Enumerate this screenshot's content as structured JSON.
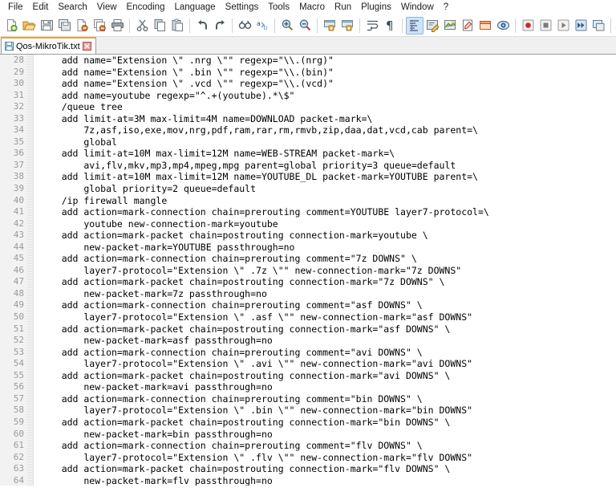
{
  "app": {
    "name": "Notepad++",
    "accent_color": "#e8a33d",
    "toolbar_active_bg": "#cfe3f7"
  },
  "menubar": {
    "items": [
      {
        "label": "File",
        "name": "menu-file"
      },
      {
        "label": "Edit",
        "name": "menu-edit"
      },
      {
        "label": "Search",
        "name": "menu-search"
      },
      {
        "label": "View",
        "name": "menu-view"
      },
      {
        "label": "Encoding",
        "name": "menu-encoding"
      },
      {
        "label": "Language",
        "name": "menu-language"
      },
      {
        "label": "Settings",
        "name": "menu-settings"
      },
      {
        "label": "Tools",
        "name": "menu-tools"
      },
      {
        "label": "Macro",
        "name": "menu-macro"
      },
      {
        "label": "Run",
        "name": "menu-run"
      },
      {
        "label": "Plugins",
        "name": "menu-plugins"
      },
      {
        "label": "Window",
        "name": "menu-window"
      },
      {
        "label": "?",
        "name": "menu-help"
      }
    ]
  },
  "toolbar": {
    "buttons": [
      {
        "icon": "new-file-icon",
        "group": 1
      },
      {
        "icon": "open-file-icon",
        "group": 1
      },
      {
        "icon": "save-icon",
        "group": 1
      },
      {
        "icon": "save-all-icon",
        "group": 1
      },
      {
        "icon": "close-file-icon",
        "group": 1
      },
      {
        "icon": "close-all-files-icon",
        "group": 1
      },
      {
        "icon": "print-icon",
        "group": 1
      },
      {
        "icon": "cut-icon",
        "group": 2
      },
      {
        "icon": "copy-icon",
        "group": 2
      },
      {
        "icon": "paste-icon",
        "group": 2
      },
      {
        "icon": "undo-icon",
        "group": 3
      },
      {
        "icon": "redo-icon",
        "group": 3
      },
      {
        "icon": "find-icon",
        "group": 4
      },
      {
        "icon": "replace-icon",
        "group": 4
      },
      {
        "icon": "zoom-in-icon",
        "group": 5
      },
      {
        "icon": "zoom-out-icon",
        "group": 5
      },
      {
        "icon": "sync-vertical-scroll-icon",
        "group": 6
      },
      {
        "icon": "sync-horizontal-scroll-icon",
        "group": 6
      },
      {
        "icon": "word-wrap-icon",
        "group": 7
      },
      {
        "icon": "show-all-characters-icon",
        "group": 7
      },
      {
        "icon": "indent-guide-icon",
        "group": 8,
        "active": true
      },
      {
        "icon": "user-defined-language-icon",
        "group": 8
      },
      {
        "icon": "document-map-icon",
        "group": 8
      },
      {
        "icon": "function-list-icon",
        "group": 8
      },
      {
        "icon": "folder-as-workspace-icon",
        "group": 8
      },
      {
        "icon": "monitoring-icon",
        "group": 8
      },
      {
        "icon": "record-macro-icon",
        "group": 9
      },
      {
        "icon": "stop-recording-icon",
        "group": 9
      },
      {
        "icon": "play-macro-icon",
        "group": 9
      },
      {
        "icon": "run-macro-multiple-icon",
        "group": 9
      },
      {
        "icon": "save-macro-icon",
        "group": 9
      },
      {
        "icon": "spell-check-icon",
        "group": 10
      }
    ]
  },
  "tabs": {
    "active_index": 0,
    "items": [
      {
        "title": "Qos-MikroTik.txt",
        "icon": "saved-document-icon",
        "close_icon": "close-icon"
      }
    ]
  },
  "editor": {
    "first_line_number": 28,
    "lines": [
      {
        "n": "28",
        "text": "    add name=\"Extension \\\" .nrg \\\"\" regexp=\"\\\\.(nrg)\""
      },
      {
        "n": "29",
        "text": "    add name=\"Extension \\\" .bin \\\"\" regexp=\"\\\\.(bin)\""
      },
      {
        "n": "30",
        "text": "    add name=\"Extension \\\" .vcd \\\"\" regexp=\"\\\\.(vcd)\""
      },
      {
        "n": "31",
        "text": "    add name=youtube regexp=\"^.+(youtube).*\\$\""
      },
      {
        "n": "32",
        "text": "    /queue tree"
      },
      {
        "n": "33",
        "text": "    add limit-at=3M max-limit=4M name=DOWNLOAD packet-mark=\\"
      },
      {
        "n": "34",
        "text": "        7z,asf,iso,exe,mov,nrg,pdf,ram,rar,rm,rmvb,zip,daa,dat,vcd,cab parent=\\"
      },
      {
        "n": "35",
        "text": "        global"
      },
      {
        "n": "36",
        "text": "    add limit-at=10M max-limit=12M name=WEB-STREAM packet-mark=\\"
      },
      {
        "n": "37",
        "text": "        avi,flv,mkv,mp3,mp4,mpeg,mpg parent=global priority=3 queue=default"
      },
      {
        "n": "38",
        "text": "    add limit-at=10M max-limit=12M name=YOUTUBE_DL packet-mark=YOUTUBE parent=\\"
      },
      {
        "n": "39",
        "text": "        global priority=2 queue=default"
      },
      {
        "n": "40",
        "text": "    /ip firewall mangle"
      },
      {
        "n": "41",
        "text": "    add action=mark-connection chain=prerouting comment=YOUTUBE layer7-protocol=\\"
      },
      {
        "n": "42",
        "text": "        youtube new-connection-mark=youtube"
      },
      {
        "n": "43",
        "text": "    add action=mark-packet chain=postrouting connection-mark=youtube \\"
      },
      {
        "n": "44",
        "text": "        new-packet-mark=YOUTUBE passthrough=no"
      },
      {
        "n": "45",
        "text": "    add action=mark-connection chain=prerouting comment=\"7z DOWNS\" \\"
      },
      {
        "n": "46",
        "text": "        layer7-protocol=\"Extension \\\" .7z \\\"\" new-connection-mark=\"7z DOWNS\""
      },
      {
        "n": "47",
        "text": "    add action=mark-packet chain=postrouting connection-mark=\"7z DOWNS\" \\"
      },
      {
        "n": "48",
        "text": "        new-packet-mark=7z passthrough=no"
      },
      {
        "n": "49",
        "text": "    add action=mark-connection chain=prerouting comment=\"asf DOWNS\" \\"
      },
      {
        "n": "50",
        "text": "        layer7-protocol=\"Extension \\\" .asf \\\"\" new-connection-mark=\"asf DOWNS\""
      },
      {
        "n": "51",
        "text": "    add action=mark-packet chain=postrouting connection-mark=\"asf DOWNS\" \\"
      },
      {
        "n": "52",
        "text": "        new-packet-mark=asf passthrough=no"
      },
      {
        "n": "53",
        "text": "    add action=mark-connection chain=prerouting comment=\"avi DOWNS\" \\"
      },
      {
        "n": "54",
        "text": "        layer7-protocol=\"Extension \\\" .avi \\\"\" new-connection-mark=\"avi DOWNS\""
      },
      {
        "n": "55",
        "text": "    add action=mark-packet chain=postrouting connection-mark=\"avi DOWNS\" \\"
      },
      {
        "n": "56",
        "text": "        new-packet-mark=avi passthrough=no"
      },
      {
        "n": "57",
        "text": "    add action=mark-connection chain=prerouting comment=\"bin DOWNS\" \\"
      },
      {
        "n": "58",
        "text": "        layer7-protocol=\"Extension \\\" .bin \\\"\" new-connection-mark=\"bin DOWNS\""
      },
      {
        "n": "59",
        "text": "    add action=mark-packet chain=postrouting connection-mark=\"bin DOWNS\" \\"
      },
      {
        "n": "60",
        "text": "        new-packet-mark=bin passthrough=no"
      },
      {
        "n": "61",
        "text": "    add action=mark-connection chain=prerouting comment=\"flv DOWNS\" \\"
      },
      {
        "n": "62",
        "text": "        layer7-protocol=\"Extension \\\" .flv \\\"\" new-connection-mark=\"flv DOWNS\""
      },
      {
        "n": "63",
        "text": "    add action=mark-packet chain=postrouting connection-mark=\"flv DOWNS\" \\"
      },
      {
        "n": "64",
        "text": "        new-packet-mark=flv passthrough=no"
      }
    ]
  }
}
